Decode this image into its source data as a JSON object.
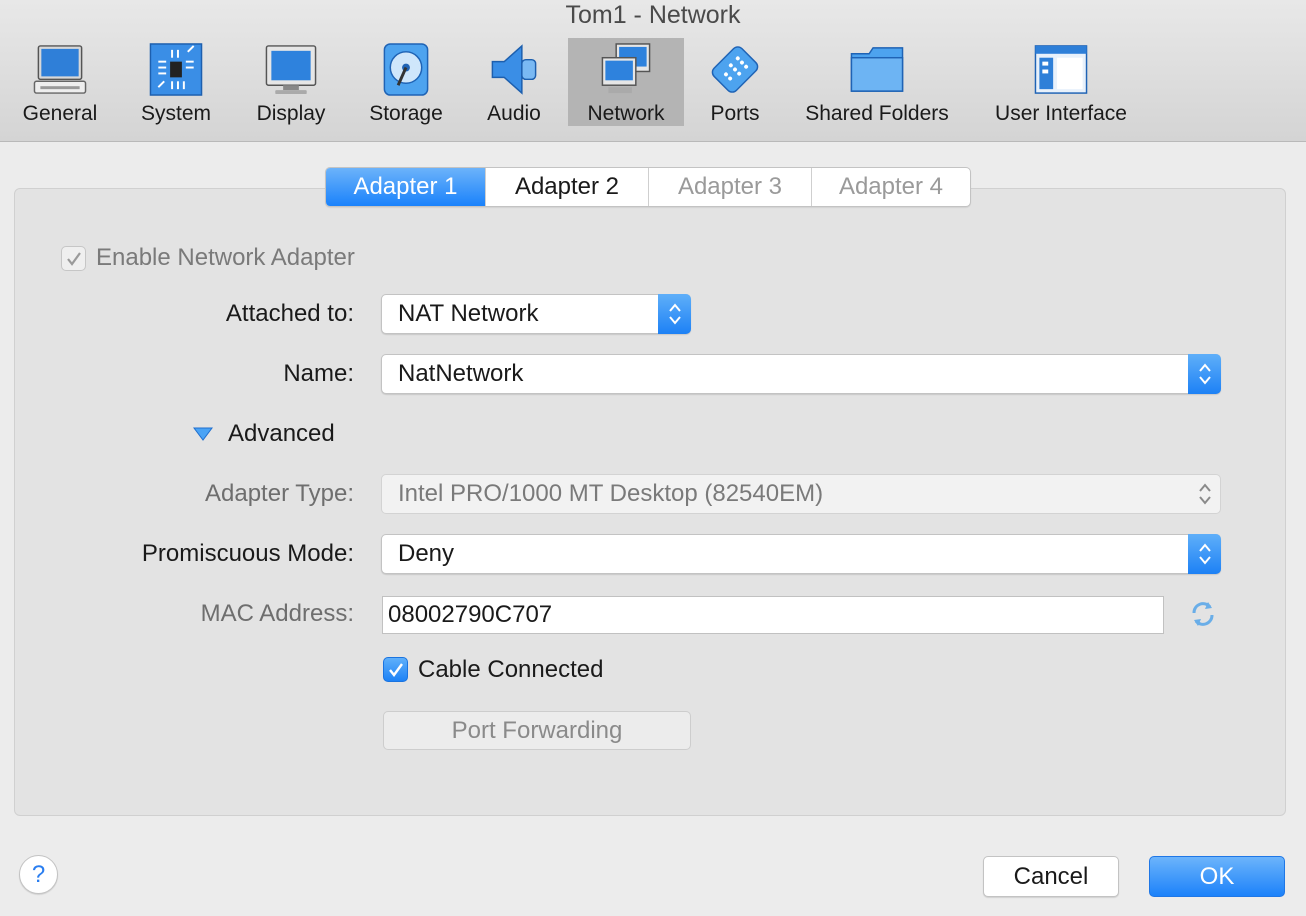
{
  "window": {
    "title": "Tom1 - Network"
  },
  "toolbar": {
    "items": [
      {
        "label": "General",
        "icon": "monitor-icon"
      },
      {
        "label": "System",
        "icon": "chip-icon"
      },
      {
        "label": "Display",
        "icon": "display-icon"
      },
      {
        "label": "Storage",
        "icon": "disk-icon"
      },
      {
        "label": "Audio",
        "icon": "speaker-icon"
      },
      {
        "label": "Network",
        "icon": "network-icon",
        "active": true
      },
      {
        "label": "Ports",
        "icon": "ports-icon"
      },
      {
        "label": "Shared Folders",
        "icon": "folder-icon"
      },
      {
        "label": "User Interface",
        "icon": "window-icon"
      }
    ]
  },
  "tabs": [
    {
      "label": "Adapter 1",
      "selected": true
    },
    {
      "label": "Adapter 2"
    },
    {
      "label": "Adapter 3",
      "disabled": true
    },
    {
      "label": "Adapter 4",
      "disabled": true
    }
  ],
  "form": {
    "enable_adapter": {
      "label": "Enable Network Adapter",
      "checked": true,
      "disabled": true
    },
    "attached_to": {
      "label": "Attached to:",
      "value": "NAT Network"
    },
    "name": {
      "label": "Name:",
      "value": "NatNetwork"
    },
    "advanced": {
      "label": "Advanced",
      "expanded": true
    },
    "adapter_type": {
      "label": "Adapter Type:",
      "value": "Intel PRO/1000 MT Desktop (82540EM)",
      "disabled": true
    },
    "promiscuous_mode": {
      "label": "Promiscuous Mode:",
      "value": "Deny"
    },
    "mac_address": {
      "label": "MAC Address:",
      "value": "08002790C707",
      "refresh_icon": "refresh-icon"
    },
    "cable_connected": {
      "label": "Cable Connected",
      "checked": true
    },
    "port_forwarding": {
      "label": "Port Forwarding",
      "disabled": true
    }
  },
  "footer": {
    "help_label": "?",
    "cancel_label": "Cancel",
    "ok_label": "OK"
  },
  "colors": {
    "accent": "#1a82fb",
    "toolbar_bg": "#d9d9d9",
    "panel_bg": "#e3e3e3"
  }
}
